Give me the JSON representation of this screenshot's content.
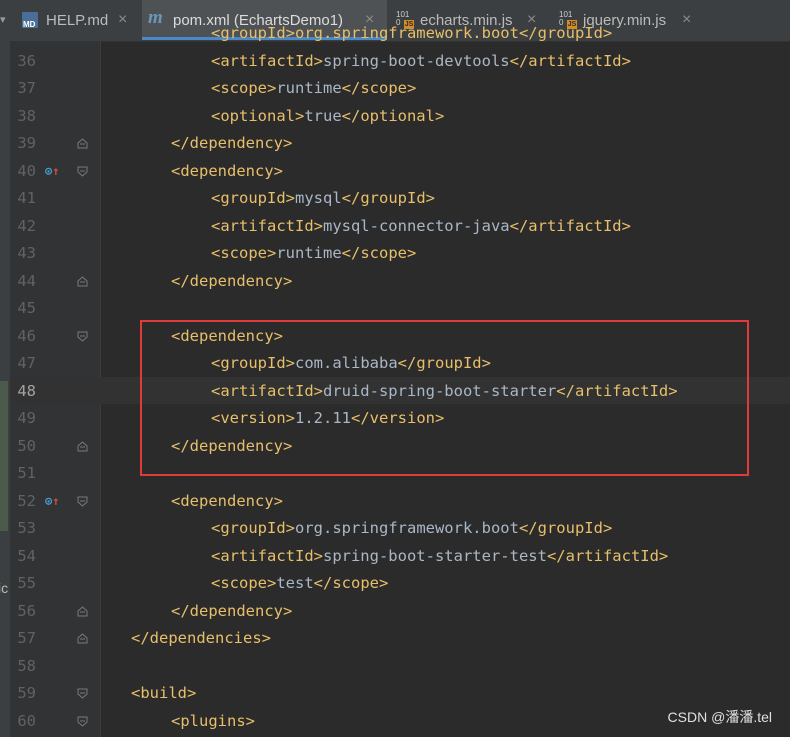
{
  "tabs": [
    {
      "label": "HELP.md",
      "icon": "markdown-file-icon",
      "icon_text": "MD",
      "active": false
    },
    {
      "label": "pom.xml (EchartsDemo1)",
      "icon": "maven-file-icon",
      "icon_text": "m",
      "active": true
    },
    {
      "label": "echarts.min.js",
      "icon": "javascript-file-icon",
      "icon_text": "JS",
      "active": false
    },
    {
      "label": "jquery.min.js",
      "icon": "javascript-file-icon",
      "icon_text": "JS",
      "active": false
    }
  ],
  "tab_close_glyph": "×",
  "tab_scroll_glyph": "▾",
  "left_strip_text": "ic",
  "current_line": "48",
  "lines": [
    {
      "n": "36",
      "indent": 3,
      "open": "artifactId",
      "text": "spring-boot-devtools"
    },
    {
      "n": "37",
      "indent": 3,
      "open": "scope",
      "text": "runtime"
    },
    {
      "n": "38",
      "indent": 3,
      "open": "optional",
      "text": "true"
    },
    {
      "n": "39",
      "indent": 2,
      "close": "dependency",
      "fold": "end"
    },
    {
      "n": "40",
      "indent": 2,
      "open": "dependency",
      "fold": "start",
      "marker": true
    },
    {
      "n": "41",
      "indent": 3,
      "open": "groupId",
      "text": "mysql"
    },
    {
      "n": "42",
      "indent": 3,
      "open": "artifactId",
      "text": "mysql-connector-java"
    },
    {
      "n": "43",
      "indent": 3,
      "open": "scope",
      "text": "runtime"
    },
    {
      "n": "44",
      "indent": 2,
      "close": "dependency",
      "fold": "end"
    },
    {
      "n": "45",
      "indent": 0
    },
    {
      "n": "46",
      "indent": 2,
      "open": "dependency",
      "fold": "start"
    },
    {
      "n": "47",
      "indent": 3,
      "open": "groupId",
      "text": "com.alibaba"
    },
    {
      "n": "48",
      "indent": 3,
      "open": "artifactId",
      "text": "druid-spring-boot-starter"
    },
    {
      "n": "49",
      "indent": 3,
      "open": "version",
      "text": "1.2.11"
    },
    {
      "n": "50",
      "indent": 2,
      "close": "dependency",
      "fold": "end"
    },
    {
      "n": "51",
      "indent": 0
    },
    {
      "n": "52",
      "indent": 2,
      "open": "dependency",
      "fold": "start",
      "marker": true
    },
    {
      "n": "53",
      "indent": 3,
      "open": "groupId",
      "text": "org.springframework.boot"
    },
    {
      "n": "54",
      "indent": 3,
      "open": "artifactId",
      "text": "spring-boot-starter-test"
    },
    {
      "n": "55",
      "indent": 3,
      "open": "scope",
      "text": "test"
    },
    {
      "n": "56",
      "indent": 2,
      "close": "dependency",
      "fold": "end"
    },
    {
      "n": "57",
      "indent": 1,
      "close": "dependencies",
      "fold": "end"
    },
    {
      "n": "58",
      "indent": 0
    },
    {
      "n": "59",
      "indent": 1,
      "open": "build",
      "fold": "start"
    },
    {
      "n": "60",
      "indent": 2,
      "open": "plugins",
      "fold": "start"
    }
  ],
  "top_partial_line": "<groupId>org.springframework.boot</groupId>",
  "watermark": "CSDN @潘潘.tel",
  "colors": {
    "tag": "#e8bf6a",
    "text": "#a9b7c6",
    "highlight_box": "#e03a3a",
    "line_number": "#606366"
  }
}
